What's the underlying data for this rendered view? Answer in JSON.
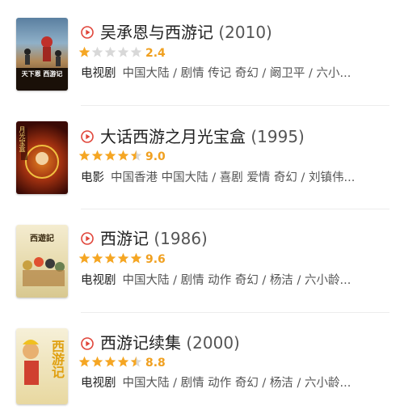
{
  "items": [
    {
      "title": "吴承恩与西游记",
      "year": "(2010)",
      "rating": 1,
      "score": "2.4",
      "type": "电视剧",
      "details": "中国大陆 / 剧情 传记 奇幻 / 阚卫平 / 六小...",
      "poster_text": "天下恩 西游记"
    },
    {
      "title": "大话西游之月光宝盒",
      "year": "(1995)",
      "rating": 4.5,
      "score": "9.0",
      "type": "电影",
      "details": "中国香港 中国大陆 / 喜剧 爱情 奇幻 / 刘镇伟...",
      "poster_text": "月光宝盒"
    },
    {
      "title": "西游记",
      "year": "(1986)",
      "rating": 5,
      "score": "9.6",
      "type": "电视剧",
      "details": "中国大陆 / 剧情 动作 奇幻 / 杨洁 / 六小龄...",
      "poster_text": "西遊記"
    },
    {
      "title": "西游记续集",
      "year": "(2000)",
      "rating": 4.5,
      "score": "8.8",
      "type": "电视剧",
      "details": "中国大陆 / 剧情 动作 奇幻 / 杨洁 / 六小龄...",
      "poster_text": "西游记"
    }
  ],
  "colors": {
    "accent_play": "#e0453a",
    "star_filled": "#f5a623",
    "star_empty": "#d8d8d8",
    "score": "#f0a020"
  }
}
